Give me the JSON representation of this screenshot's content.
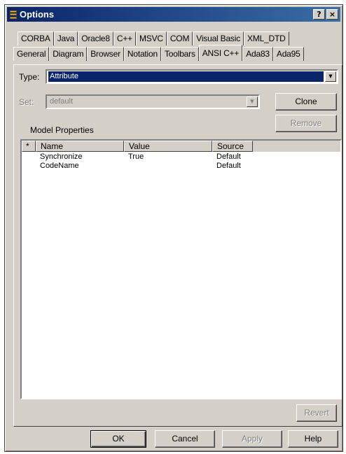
{
  "window": {
    "title": "Options",
    "help_button": "?",
    "close_button": "×"
  },
  "tabs": {
    "row1": [
      "CORBA",
      "Java",
      "Oracle8",
      "C++",
      "MSVC",
      "COM",
      "Visual Basic",
      "XML_DTD"
    ],
    "row2": [
      "General",
      "Diagram",
      "Browser",
      "Notation",
      "Toolbars",
      "ANSI C++",
      "Ada83",
      "Ada95"
    ],
    "active": "ANSI C++"
  },
  "type": {
    "label": "Type:",
    "value": "Attribute"
  },
  "set": {
    "label": "Set:",
    "value": "default"
  },
  "buttons": {
    "clone": "Clone",
    "remove": "Remove",
    "revert": "Revert",
    "ok": "OK",
    "cancel": "Cancel",
    "apply": "Apply",
    "help": "Help"
  },
  "model_properties": {
    "label": "Model Properties",
    "columns": [
      "*",
      "Name",
      "Value",
      "Source"
    ],
    "rows": [
      {
        "marker": "",
        "name": "Synchronize",
        "value": "True",
        "source": "Default"
      },
      {
        "marker": "",
        "name": "CodeName",
        "value": "",
        "source": "Default"
      }
    ]
  }
}
